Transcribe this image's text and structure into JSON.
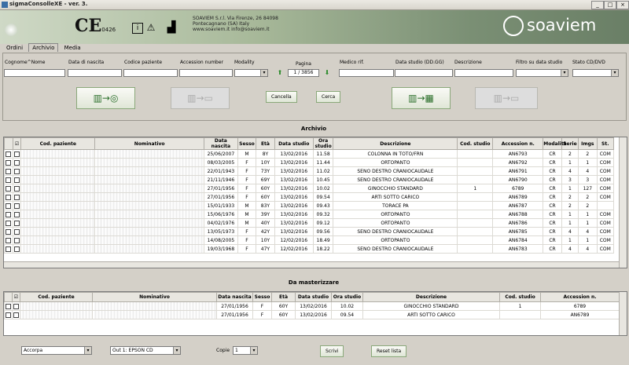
{
  "window": {
    "title": "sigmaConsolleXE - ver. 3.",
    "minimize": "_",
    "maximize": "□",
    "close": "×"
  },
  "header": {
    "ce_mark": "CE",
    "ce_number": "0426",
    "info_icon": "i",
    "warning_icon": "⚠",
    "factory_icon": "▟",
    "company_lines": [
      "SOAVIEM S.r.l. Via Firenze, 26 84098",
      "Pontecagnano (SA) Italy",
      "www.soaviem.it   info@soaviem.it"
    ],
    "logo_text": "soaviem"
  },
  "tabs": [
    "Ordini",
    "Archivio",
    "Media"
  ],
  "active_tab": "Archivio",
  "filters": {
    "labels": [
      "Cognome^Nome",
      "Data di nascita",
      "Codice paziente",
      "Accession number",
      "Modality",
      "Pagina",
      "Medico rif.",
      "Data studio (DD.GG)",
      "Descrizione",
      "Filtro su data studio",
      "Stato CD/DVD"
    ],
    "page_value": "1 / 3856"
  },
  "buttons": {
    "cancella": "Cancella",
    "cerca": "Cerca",
    "scrivi": "Scrivi",
    "reset_lista": "Reset lista",
    "big1_icon": "▥→◎",
    "big2_icon": "▥→▭",
    "big3_icon": "▥→▦",
    "big4_icon": "▥→▭",
    "up_icon": "⬆",
    "down_icon": "⬇"
  },
  "archivio": {
    "title": "Archivio",
    "columns": [
      "",
      "☑",
      "Cod. paziente",
      "Nominativo",
      "Data nascita",
      "Sesso",
      "Età",
      "Data studio",
      "Ora studio",
      "Descrizione",
      "Cod. studio",
      "Accession n.",
      "Modalità",
      "Serie",
      "Imgs",
      "St."
    ],
    "rows": [
      [
        "",
        "",
        "",
        "25/06/2007",
        "M",
        "8Y",
        "13/02/2016",
        "11.58",
        "COLONNA IN TOTO/FRN",
        "",
        "AN6793",
        "CR",
        "2",
        "2",
        "COM"
      ],
      [
        "",
        "",
        "",
        "08/03/2005",
        "F",
        "10Y",
        "13/02/2016",
        "11.44",
        "ORTOPANTO",
        "",
        "AN6792",
        "CR",
        "1",
        "1",
        "COM"
      ],
      [
        "",
        "",
        "",
        "22/01/1943",
        "F",
        "73Y",
        "13/02/2016",
        "11.02",
        "SENO DESTRO CRANIOCAUDALE",
        "",
        "AN6791",
        "CR",
        "4",
        "4",
        "COM"
      ],
      [
        "",
        "",
        "",
        "21/11/1946",
        "F",
        "69Y",
        "13/02/2016",
        "10.45",
        "SENO DESTRO CRANIOCAUDALE",
        "",
        "AN6790",
        "CR",
        "3",
        "3",
        "COM"
      ],
      [
        "",
        "",
        "",
        "27/01/1956",
        "F",
        "60Y",
        "13/02/2016",
        "10.02",
        "GINOCCHIO STANDARD",
        "1",
        "6789",
        "CR",
        "1",
        "127",
        "COM"
      ],
      [
        "",
        "",
        "",
        "27/01/1956",
        "F",
        "60Y",
        "13/02/2016",
        "09.54",
        "ARTI SOTTO CARICO",
        "",
        "AN6789",
        "CR",
        "2",
        "2",
        "COM"
      ],
      [
        "",
        "",
        "",
        "15/01/1933",
        "M",
        "83Y",
        "13/02/2016",
        "09.43",
        "TORACE PA",
        "",
        "AN6787",
        "CR",
        "2",
        "2",
        ""
      ],
      [
        "",
        "",
        "",
        "15/06/1976",
        "M",
        "39Y",
        "13/02/2016",
        "09.32",
        "ORTOPANTO",
        "",
        "AN6788",
        "CR",
        "1",
        "1",
        "COM"
      ],
      [
        "",
        "",
        "",
        "04/02/1976",
        "M",
        "40Y",
        "13/02/2016",
        "09.12",
        "ORTOPANTO",
        "",
        "AN6786",
        "CR",
        "1",
        "1",
        "COM"
      ],
      [
        "",
        "",
        "",
        "13/05/1973",
        "F",
        "42Y",
        "13/02/2016",
        "09.56",
        "SENO DESTRO CRANIOCAUDALE",
        "",
        "AN6785",
        "CR",
        "4",
        "4",
        "COM"
      ],
      [
        "",
        "",
        "",
        "14/08/2005",
        "F",
        "10Y",
        "12/02/2016",
        "18.49",
        "ORTOPANTO",
        "",
        "AN6784",
        "CR",
        "1",
        "1",
        "COM"
      ],
      [
        "",
        "",
        "",
        "19/03/1968",
        "F",
        "47Y",
        "12/02/2016",
        "18.22",
        "SENO DESTRO CRANIOCAUDALE",
        "",
        "AN6783",
        "CR",
        "4",
        "4",
        "COM"
      ]
    ]
  },
  "masterizzare": {
    "title": "Da masterizzare",
    "columns": [
      "",
      "☑",
      "Cod. paziente",
      "Nominativo",
      "Data nascita",
      "Sesso",
      "Età",
      "Data studio",
      "Ora studio",
      "Descrizione",
      "Cod. studio",
      "Accession n."
    ],
    "rows": [
      [
        "",
        "",
        "27/01/1956",
        "F",
        "60Y",
        "13/02/2016",
        "10.02",
        "GINOCCHIO STANDARD",
        "1",
        "6789"
      ],
      [
        "",
        "",
        "27/01/1956",
        "F",
        "60Y",
        "13/02/2016",
        "09.54",
        "ARTI SOTTO CARICO",
        "",
        "AN6789"
      ]
    ]
  },
  "bottom": {
    "select1": "Accorpa",
    "select2": "Out 1: EPSON CD",
    "copie_label": "Copie",
    "copie_value": "1"
  }
}
